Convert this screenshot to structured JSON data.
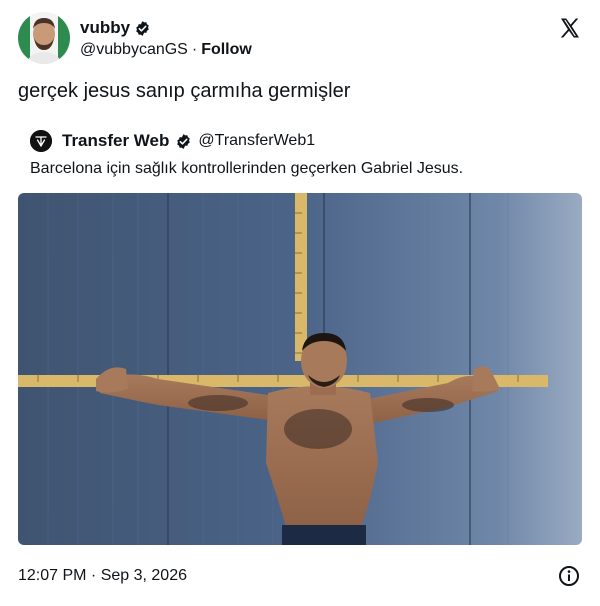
{
  "author": {
    "display_name": "vubby",
    "handle": "@vubbycanGS",
    "separator": "·",
    "follow_label": "Follow"
  },
  "tweet": {
    "text": "gerçek jesus sanıp çarmıha germişler"
  },
  "quoted_tweet": {
    "display_name": "Transfer Web",
    "handle": "@TransferWeb1",
    "text": "Barcelona için sağlık kontrollerinden geçerken Gabriel Jesus."
  },
  "media": {
    "description_icon": "photo"
  },
  "footer": {
    "timestamp": "12:07 PM · Sep 3, 2026"
  },
  "icons": {
    "verified": "verified-badge-icon",
    "x_logo": "x-logo-icon",
    "info": "info-icon"
  },
  "colors": {
    "text": "#0f1419",
    "verified_fill": "#0f1419",
    "background": "#ffffff"
  }
}
